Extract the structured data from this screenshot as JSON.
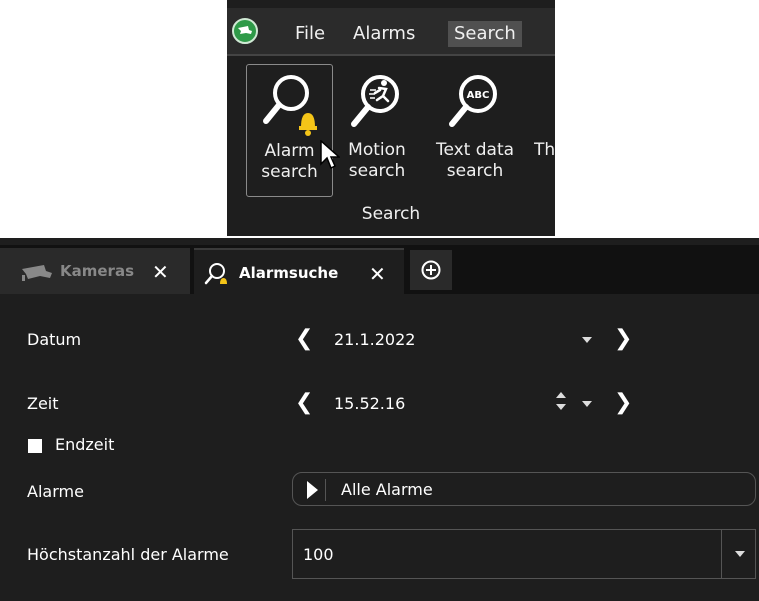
{
  "menubar": {
    "items": [
      "File",
      "Alarms",
      "Search"
    ],
    "active": "Search"
  },
  "ribbon": {
    "buttons": [
      {
        "line1": "Alarm",
        "line2": "search",
        "icon": "magnifier-bell-icon"
      },
      {
        "line1": "Motion",
        "line2": "search",
        "icon": "magnifier-runner-icon"
      },
      {
        "line1": "Text data",
        "line2": "search",
        "icon": "magnifier-abc-icon"
      },
      {
        "line1": "Th",
        "line2": ""
      }
    ],
    "group_label": "Search"
  },
  "tabs": [
    {
      "label": "Kameras",
      "icon": "camera-icon",
      "active": false
    },
    {
      "label": "Alarmsuche",
      "icon": "magnifier-bell-icon",
      "active": true
    }
  ],
  "form": {
    "datum": {
      "label": "Datum",
      "value": "21.1.2022"
    },
    "zeit": {
      "label": "Zeit",
      "value": "15.52.16"
    },
    "endzeit": {
      "label": "Endzeit",
      "checked": false
    },
    "alarme": {
      "label": "Alarme",
      "value": "Alle Alarme"
    },
    "max_alarme": {
      "label": "Höchstanzahl der Alarme",
      "value": "100"
    }
  },
  "colors": {
    "background": "#1e1e1e",
    "menu_active": "#505050",
    "bell": "#f5c518",
    "logo": "#2e9a48"
  }
}
